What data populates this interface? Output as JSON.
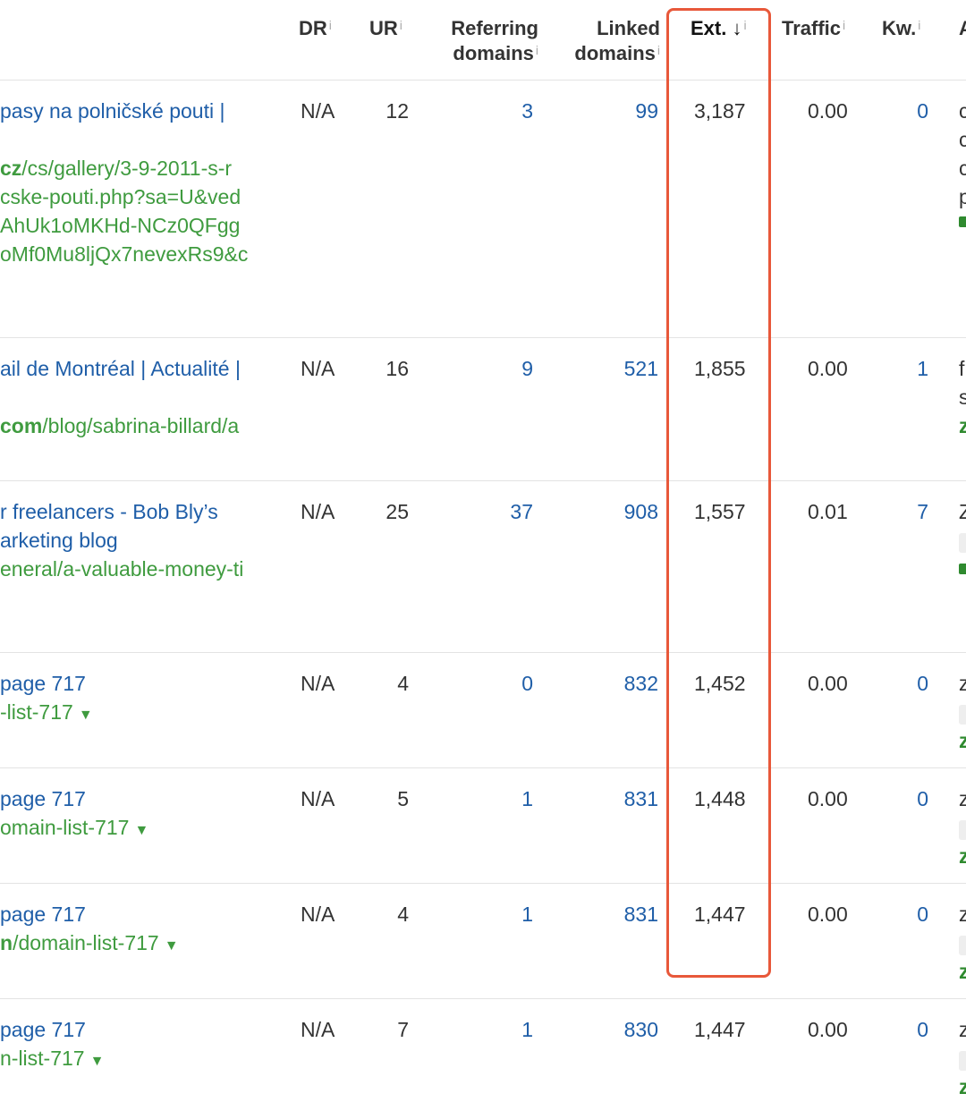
{
  "headers": {
    "dr": "DR",
    "ur": "UR",
    "referring_1": "Referring",
    "referring_2": "domains",
    "linked_1": "Linked",
    "linked_2": "domains",
    "ext": "Ext.",
    "ext_sort": "↓",
    "traffic": "Traffic",
    "kw": "Kw.",
    "next": "A",
    "info": "i"
  },
  "rows": [
    {
      "title_lines": [
        "pasy na polničské pouti |"
      ],
      "url_lines": [
        "cz/cs/gallery/3-9-2011-s-r",
        "cske-pouti.php?sa=U&ved",
        "AhUk1oMKHd-NCz0QFgg",
        "oMf0Mu8ljQx7nevexRs9&c"
      ],
      "url_bold": "cz",
      "dr": "N/A",
      "ur": "12",
      "ref": "3",
      "linked": "99",
      "ext": "3,187",
      "traffic": "0.00",
      "kw": "0",
      "edge": [
        "c",
        "c",
        "c",
        "p"
      ]
    },
    {
      "title_lines": [
        "ail de Montréal | Actualité |"
      ],
      "url_lines": [
        "com/blog/sabrina-billard/a"
      ],
      "url_bold": "com",
      "dr": "N/A",
      "ur": "16",
      "ref": "9",
      "linked": "521",
      "ext": "1,855",
      "traffic": "0.00",
      "kw": "1",
      "edge": [
        "f",
        "s",
        "z"
      ]
    },
    {
      "title_lines": [
        "r freelancers - Bob Bly’s",
        "arketing blog"
      ],
      "url_lines": [
        "eneral/a-valuable-money-ti"
      ],
      "url_bold": "",
      "dr": "N/A",
      "ur": "25",
      "ref": "37",
      "linked": "908",
      "ext": "1,557",
      "traffic": "0.01",
      "kw": "7",
      "edge": [
        "Z"
      ]
    },
    {
      "title_lines": [
        "page 717"
      ],
      "url_lines": [
        "-list-717"
      ],
      "url_bold": "",
      "dr": "N/A",
      "ur": "4",
      "ref": "0",
      "linked": "832",
      "ext": "1,452",
      "traffic": "0.00",
      "kw": "0",
      "edge": [
        "z",
        "z"
      ]
    },
    {
      "title_lines": [
        "page 717"
      ],
      "url_lines": [
        "omain-list-717"
      ],
      "url_bold": "",
      "dr": "N/A",
      "ur": "5",
      "ref": "1",
      "linked": "831",
      "ext": "1,448",
      "traffic": "0.00",
      "kw": "0",
      "edge": [
        "z",
        "z"
      ]
    },
    {
      "title_lines": [
        "page 717"
      ],
      "url_lines": [
        "n/domain-list-717"
      ],
      "url_bold": "n",
      "dr": "N/A",
      "ur": "4",
      "ref": "1",
      "linked": "831",
      "ext": "1,447",
      "traffic": "0.00",
      "kw": "0",
      "edge": [
        "z",
        "z"
      ]
    },
    {
      "title_lines": [
        "page 717"
      ],
      "url_lines": [
        "n-list-717"
      ],
      "url_bold": "",
      "dr": "N/A",
      "ur": "7",
      "ref": "1",
      "linked": "830",
      "ext": "1,447",
      "traffic": "0.00",
      "kw": "0",
      "edge": [
        "z",
        "z"
      ]
    }
  ],
  "highlight_color": "#e8583a",
  "link_color": "#1f5ea8",
  "url_color": "#3f9b3f"
}
